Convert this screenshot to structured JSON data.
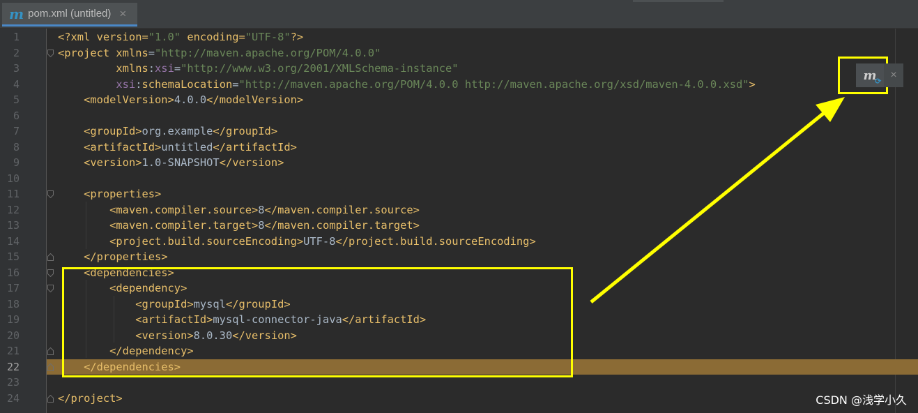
{
  "tab": {
    "title": "pom.xml (untitled)",
    "icon": "maven-file-icon",
    "close": "×"
  },
  "maven_popup": {
    "icon": "maven-reload-icon",
    "glyph": "m",
    "sync": "⟳",
    "close": "×"
  },
  "watermark": "CSDN @浅学小久",
  "colors": {
    "tag": "#e8bf6a",
    "namespace": "#9876aa",
    "string": "#6a8759",
    "text": "#a9b7c6",
    "highlight": "#8b6b35",
    "annotation": "#ffff00"
  },
  "current_line": 22,
  "lines": [
    [
      [
        "pi",
        "<?xml version="
      ],
      [
        "s",
        "\"1.0\""
      ],
      [
        "pi",
        " encoding="
      ],
      [
        "s",
        "\"UTF-8\""
      ],
      [
        "pi",
        "?>"
      ]
    ],
    [
      [
        "t",
        "<project "
      ],
      [
        "t",
        "xmlns"
      ],
      [
        "p",
        "="
      ],
      [
        "s",
        "\"http://maven.apache.org/POM/4.0.0\""
      ]
    ],
    [
      [
        "p",
        "         "
      ],
      [
        "t",
        "xmlns"
      ],
      [
        "p",
        ":"
      ],
      [
        "ns",
        "xsi"
      ],
      [
        "p",
        "="
      ],
      [
        "s",
        "\"http://www.w3.org/2001/XMLSchema-instance\""
      ]
    ],
    [
      [
        "p",
        "         "
      ],
      [
        "ns",
        "xsi"
      ],
      [
        "p",
        ":"
      ],
      [
        "t",
        "schemaLocation"
      ],
      [
        "p",
        "="
      ],
      [
        "s",
        "\"http://maven.apache.org/POM/4.0.0 http://maven.apache.org/xsd/maven-4.0.0.xsd\""
      ],
      [
        "t",
        ">"
      ]
    ],
    [
      [
        "p",
        "    "
      ],
      [
        "t",
        "<modelVersion>"
      ],
      [
        "p",
        "4.0.0"
      ],
      [
        "t",
        "</modelVersion>"
      ]
    ],
    [],
    [
      [
        "p",
        "    "
      ],
      [
        "t",
        "<groupId>"
      ],
      [
        "p",
        "org.example"
      ],
      [
        "t",
        "</groupId>"
      ]
    ],
    [
      [
        "p",
        "    "
      ],
      [
        "t",
        "<artifactId>"
      ],
      [
        "p",
        "untitled"
      ],
      [
        "t",
        "</artifactId>"
      ]
    ],
    [
      [
        "p",
        "    "
      ],
      [
        "t",
        "<version>"
      ],
      [
        "p",
        "1.0-SNAPSHOT"
      ],
      [
        "t",
        "</version>"
      ]
    ],
    [],
    [
      [
        "p",
        "    "
      ],
      [
        "t",
        "<properties>"
      ]
    ],
    [
      [
        "p",
        "        "
      ],
      [
        "t",
        "<maven.compiler.source>"
      ],
      [
        "p",
        "8"
      ],
      [
        "t",
        "</maven.compiler.source>"
      ]
    ],
    [
      [
        "p",
        "        "
      ],
      [
        "t",
        "<maven.compiler.target>"
      ],
      [
        "p",
        "8"
      ],
      [
        "t",
        "</maven.compiler.target>"
      ]
    ],
    [
      [
        "p",
        "        "
      ],
      [
        "t",
        "<project.build.sourceEncoding>"
      ],
      [
        "p",
        "UTF-8"
      ],
      [
        "t",
        "</project.build.sourceEncoding>"
      ]
    ],
    [
      [
        "p",
        "    "
      ],
      [
        "t",
        "</properties>"
      ]
    ],
    [
      [
        "p",
        "    "
      ],
      [
        "t",
        "<dependencies>"
      ]
    ],
    [
      [
        "p",
        "        "
      ],
      [
        "t",
        "<dependency>"
      ]
    ],
    [
      [
        "p",
        "            "
      ],
      [
        "t",
        "<groupId>"
      ],
      [
        "p",
        "mysql"
      ],
      [
        "t",
        "</groupId>"
      ]
    ],
    [
      [
        "p",
        "            "
      ],
      [
        "t",
        "<artifactId>"
      ],
      [
        "p",
        "mysql-connector-java"
      ],
      [
        "t",
        "</artifactId>"
      ]
    ],
    [
      [
        "p",
        "            "
      ],
      [
        "t",
        "<version>"
      ],
      [
        "p",
        "8.0.30"
      ],
      [
        "t",
        "</version>"
      ]
    ],
    [
      [
        "p",
        "        "
      ],
      [
        "t",
        "</dependency>"
      ]
    ],
    [
      [
        "p",
        "    "
      ],
      [
        "t",
        "</dependencies>"
      ]
    ],
    [],
    [
      [
        "t",
        "</project>"
      ]
    ]
  ]
}
